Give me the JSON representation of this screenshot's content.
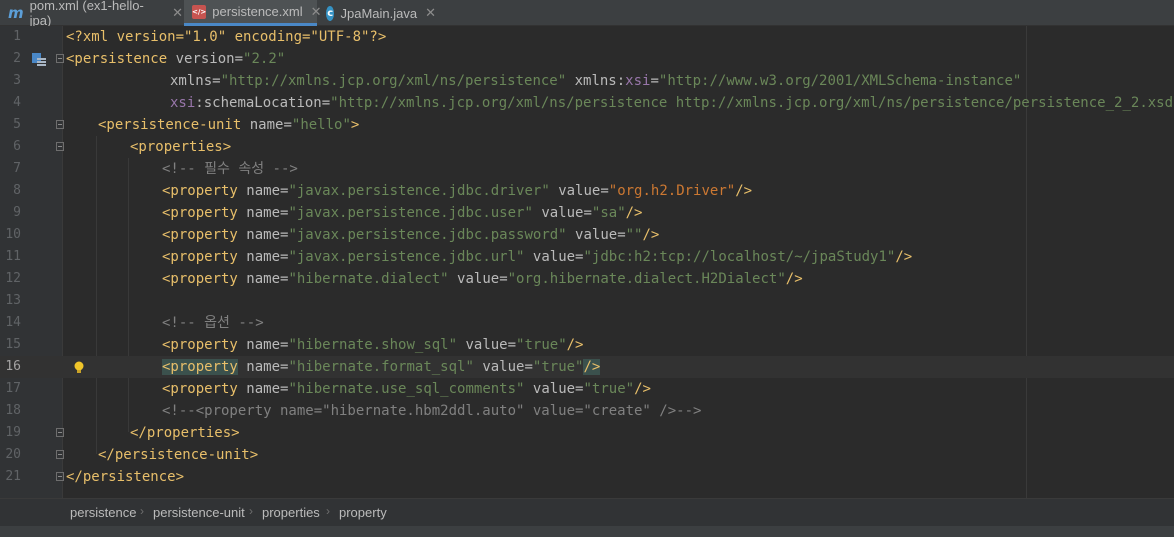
{
  "tabs": [
    {
      "label": "pom.xml (ex1-hello-jpa)",
      "icon": "maven-icon",
      "active": false
    },
    {
      "label": "persistence.xml",
      "icon": "xml-file-icon",
      "active": true
    },
    {
      "label": "JpaMain.java",
      "icon": "java-class-icon",
      "active": false
    }
  ],
  "close_glyph": "✕",
  "editor": {
    "current_line": 16,
    "lines": [
      {
        "n": "1"
      },
      {
        "n": "2"
      },
      {
        "n": "3"
      },
      {
        "n": "4"
      },
      {
        "n": "5"
      },
      {
        "n": "6"
      },
      {
        "n": "7"
      },
      {
        "n": "8"
      },
      {
        "n": "9"
      },
      {
        "n": "10"
      },
      {
        "n": "11"
      },
      {
        "n": "12"
      },
      {
        "n": "13"
      },
      {
        "n": "14"
      },
      {
        "n": "15"
      },
      {
        "n": "16"
      },
      {
        "n": "17"
      },
      {
        "n": "18"
      },
      {
        "n": "19"
      },
      {
        "n": "20"
      },
      {
        "n": "21"
      }
    ],
    "text": {
      "l1_decl": "<?xml version=\"1.0\" encoding=\"UTF-8\"?>",
      "l2_tag": "<persistence",
      "l2_attr": "version=",
      "l2_val": "\"2.2\"",
      "l3_attr1": "xmlns=",
      "l3_val1": "\"http://xmlns.jcp.org/xml/ns/persistence\"",
      "l3_attr2": "xmlns:",
      "l3_ns": "xsi",
      "l3_eq": "=",
      "l3_val2": "\"http://www.w3.org/2001/XMLSchema-instance\"",
      "l4_ns": "xsi",
      "l4_attr": ":schemaLocation=",
      "l4_val": "\"http://xmlns.jcp.org/xml/ns/persistence http://xmlns.jcp.org/xml/ns/persistence/persistence_2_2.xsd\"",
      "l4_close": ">",
      "l2_close": ">",
      "l5_tag": "<persistence-unit",
      "l5_attr": "name=",
      "l5_val": "\"hello\"",
      "l5_close": ">",
      "l6_tag": "<properties>",
      "l7_comment": "<!-- 필수 속성 -->",
      "prop_tag": "<property",
      "name_attr": "name=",
      "value_attr": "value=",
      "self_close": "/>",
      "l8_name": "\"javax.persistence.jdbc.driver\"",
      "l8_value": "\"org.h2.Driver\"",
      "l9_name": "\"javax.persistence.jdbc.user\"",
      "l9_value": "\"sa\"",
      "l10_name": "\"javax.persistence.jdbc.password\"",
      "l10_value": "\"\"",
      "l11_name": "\"javax.persistence.jdbc.url\"",
      "l11_value": "\"jdbc:h2:tcp://localhost/~/jpaStudy1\"",
      "l12_name": "\"hibernate.dialect\"",
      "l12_value": "\"org.hibernate.dialect.H2Dialect\"",
      "l14_comment": "<!-- 옵션 -->",
      "l15_name": "\"hibernate.show_sql\"",
      "l15_value": "\"true\"",
      "l16_name": "\"hibernate.format_sql\"",
      "l16_value": "\"true\"",
      "l17_name": "\"hibernate.use_sql_comments\"",
      "l17_value": "\"true\"",
      "l18_comment": "<!--<property name=\"hibernate.hbm2ddl.auto\" value=\"create\" />-->",
      "l19_tag": "</properties>",
      "l20_tag": "</persistence-unit>",
      "l21_tag": "</persistence>"
    }
  },
  "breadcrumb": [
    "persistence",
    "persistence-unit",
    "properties",
    "property"
  ],
  "breadcrumb_separator": "›",
  "colors": {
    "tag": "#e8bf6a",
    "attr": "#bababa",
    "string": "#6a8759",
    "namespace": "#9876aa",
    "comment": "#808080",
    "driver_value": "#cc7832",
    "tab_accent": "#4a88c7"
  }
}
